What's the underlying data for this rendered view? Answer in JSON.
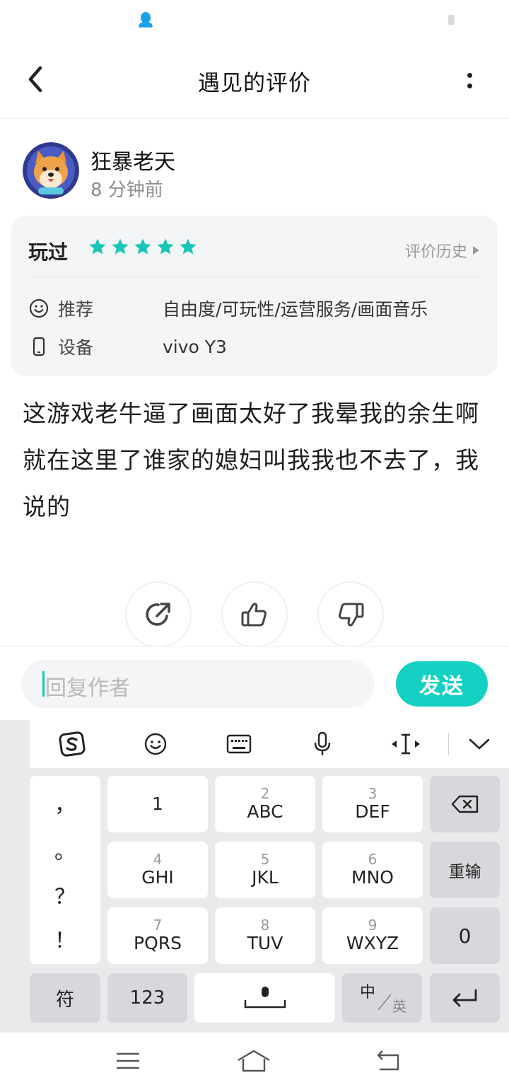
{
  "header": {
    "title": "遇见的评价"
  },
  "author": {
    "name": "狂暴老天",
    "time": "8 分钟前"
  },
  "card": {
    "played_label": "玩过",
    "rating": 5,
    "history_link": "评价历史",
    "recommend_label": "推荐",
    "recommend_value": "自由度/可玩性/运营服务/画面音乐",
    "device_label": "设备",
    "device_value": "vivo Y3",
    "star_color": "#18c7b8"
  },
  "review": {
    "text": "这游戏老牛逼了画面太好了我晕我的余生啊就在这里了谁家的媳妇叫我我也不去了，我说的"
  },
  "reply": {
    "placeholder": "回复作者",
    "send_label": "发送"
  },
  "keyboard": {
    "punctuation": [
      "，",
      "。",
      "？",
      "！"
    ],
    "keys": [
      {
        "num": "",
        "letters": "1"
      },
      {
        "num": "2",
        "letters": "ABC"
      },
      {
        "num": "3",
        "letters": "DEF"
      },
      {
        "num": "4",
        "letters": "GHI"
      },
      {
        "num": "5",
        "letters": "JKL"
      },
      {
        "num": "6",
        "letters": "MNO"
      },
      {
        "num": "7",
        "letters": "PQRS"
      },
      {
        "num": "8",
        "letters": "TUV"
      },
      {
        "num": "9",
        "letters": "WXYZ"
      }
    ],
    "retype": "重输",
    "zero": "0",
    "symbol": "符",
    "num123": "123",
    "lang_zh": "中",
    "lang_en": "英"
  },
  "colors": {
    "accent": "#14d0c2"
  }
}
